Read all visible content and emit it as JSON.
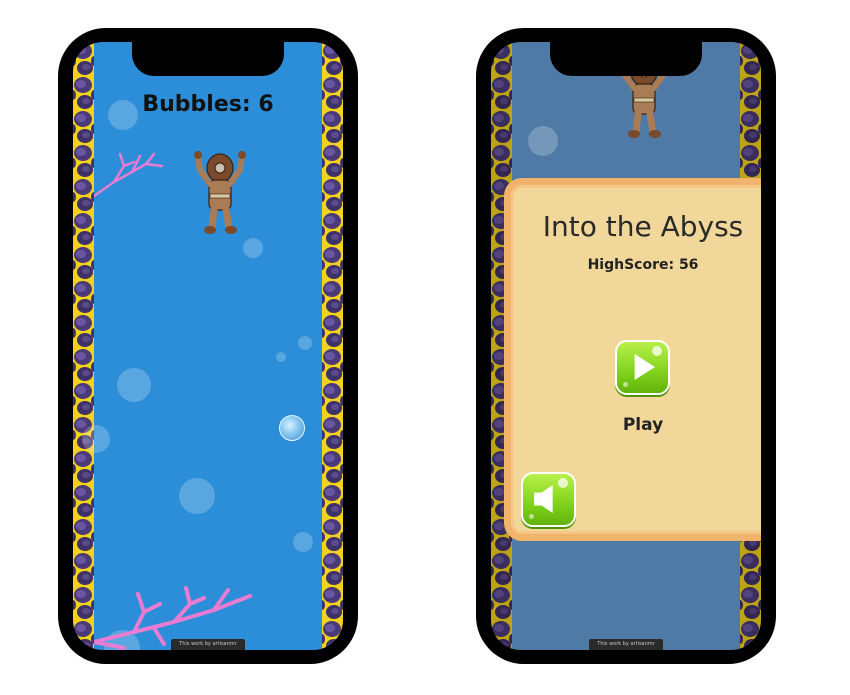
{
  "gameplay": {
    "score_label": "Bubbles: 6",
    "colors": {
      "water": "#2c8ed8",
      "coral": "#e77cd2",
      "wall": "#f4d21b"
    }
  },
  "menu": {
    "title": "Into the Abyss",
    "highscore_label": "HighScore: 56",
    "play_label": "Play",
    "icons": {
      "play": "play-icon",
      "sound": "speaker-icon"
    },
    "colors": {
      "panel": "#f2d79a",
      "panel_border": "#f0b36b",
      "button": "#7fd21b",
      "water": "#4f7aa6"
    }
  },
  "footer": {
    "watermark_text": "This work by artisanmr"
  }
}
